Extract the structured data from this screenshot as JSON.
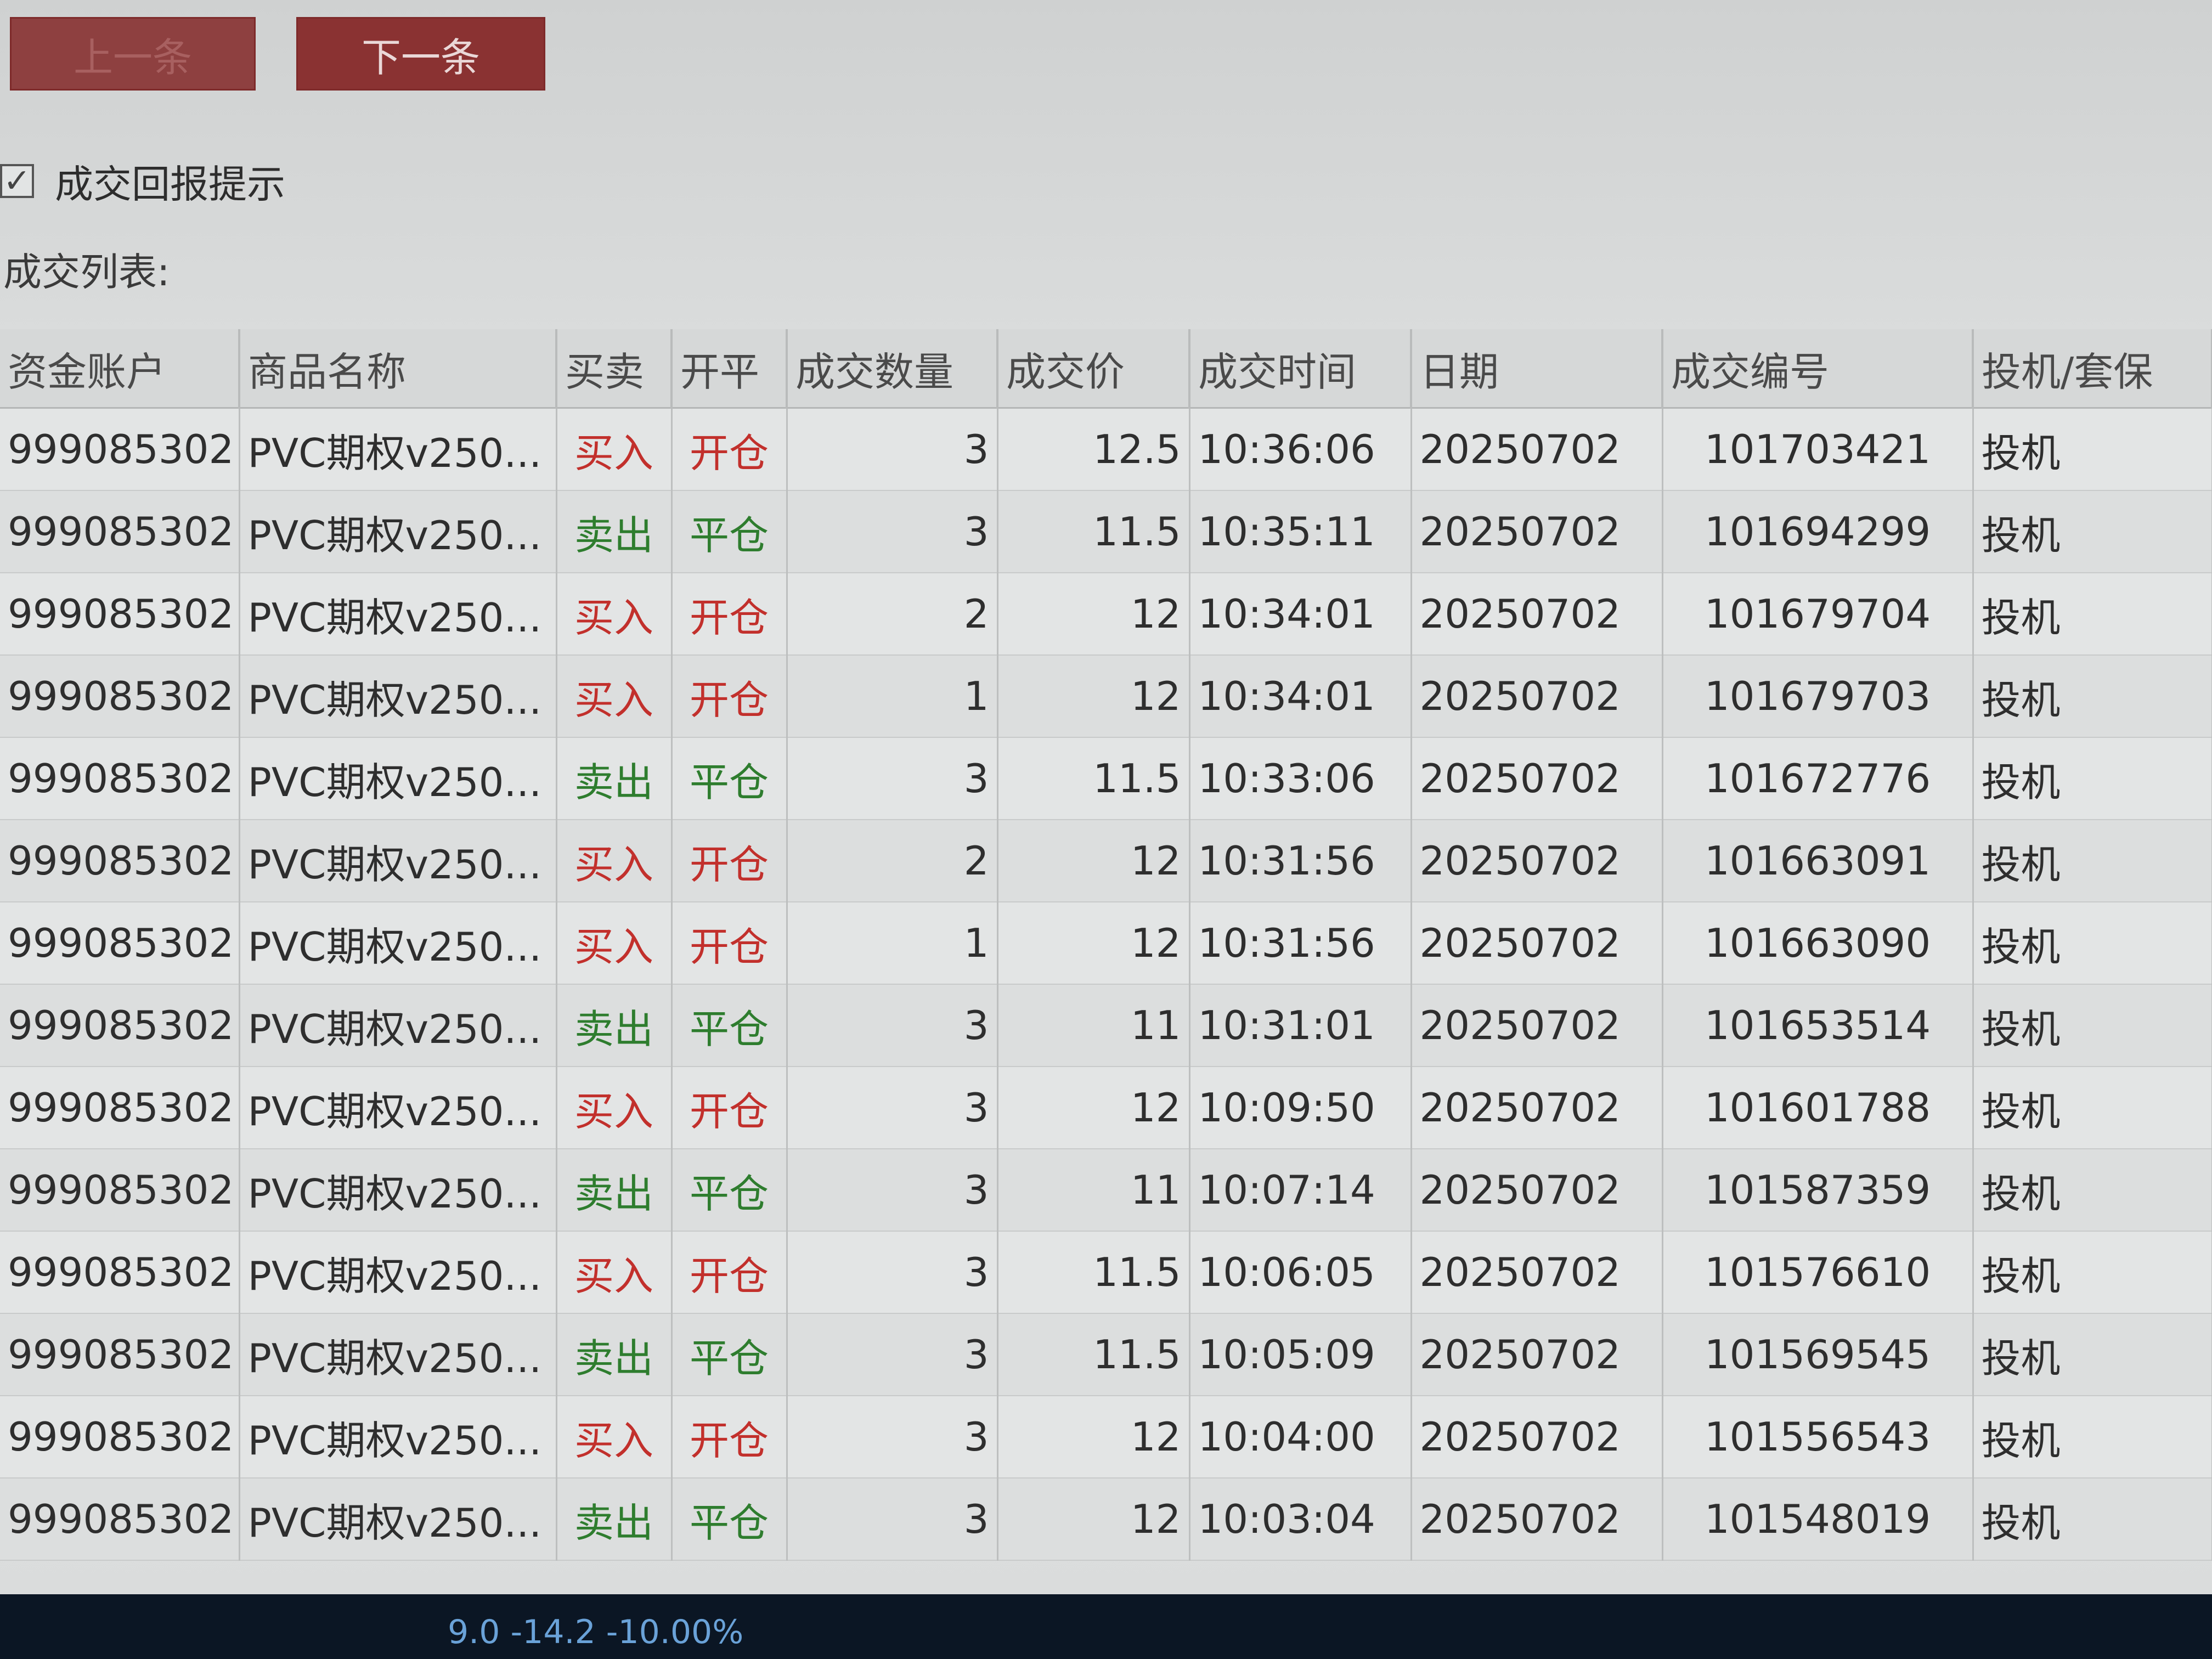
{
  "toolbar": {
    "prev_label": "上一条",
    "next_label": "下一条"
  },
  "notify": {
    "checked": true,
    "label": "成交回报提示"
  },
  "list": {
    "title": "成交列表:"
  },
  "table": {
    "headers": [
      "资金账户",
      "商品名称",
      "买卖",
      "开平",
      "成交数量",
      "成交价",
      "成交时间",
      "日期",
      "成交编号",
      "投机/套保"
    ],
    "rows": [
      {
        "account": "999085302",
        "product": "PVC期权v250...",
        "side": "买入",
        "openclose": "开仓",
        "qty": "3",
        "price": "12.5",
        "time": "10:36:06",
        "date": "20250702",
        "trade_id": "101703421",
        "hedge": "投机"
      },
      {
        "account": "999085302",
        "product": "PVC期权v250...",
        "side": "卖出",
        "openclose": "平仓",
        "qty": "3",
        "price": "11.5",
        "time": "10:35:11",
        "date": "20250702",
        "trade_id": "101694299",
        "hedge": "投机"
      },
      {
        "account": "999085302",
        "product": "PVC期权v250...",
        "side": "买入",
        "openclose": "开仓",
        "qty": "2",
        "price": "12",
        "time": "10:34:01",
        "date": "20250702",
        "trade_id": "101679704",
        "hedge": "投机"
      },
      {
        "account": "999085302",
        "product": "PVC期权v250...",
        "side": "买入",
        "openclose": "开仓",
        "qty": "1",
        "price": "12",
        "time": "10:34:01",
        "date": "20250702",
        "trade_id": "101679703",
        "hedge": "投机"
      },
      {
        "account": "999085302",
        "product": "PVC期权v250...",
        "side": "卖出",
        "openclose": "平仓",
        "qty": "3",
        "price": "11.5",
        "time": "10:33:06",
        "date": "20250702",
        "trade_id": "101672776",
        "hedge": "投机"
      },
      {
        "account": "999085302",
        "product": "PVC期权v250...",
        "side": "买入",
        "openclose": "开仓",
        "qty": "2",
        "price": "12",
        "time": "10:31:56",
        "date": "20250702",
        "trade_id": "101663091",
        "hedge": "投机"
      },
      {
        "account": "999085302",
        "product": "PVC期权v250...",
        "side": "买入",
        "openclose": "开仓",
        "qty": "1",
        "price": "12",
        "time": "10:31:56",
        "date": "20250702",
        "trade_id": "101663090",
        "hedge": "投机"
      },
      {
        "account": "999085302",
        "product": "PVC期权v250...",
        "side": "卖出",
        "openclose": "平仓",
        "qty": "3",
        "price": "11",
        "time": "10:31:01",
        "date": "20250702",
        "trade_id": "101653514",
        "hedge": "投机"
      },
      {
        "account": "999085302",
        "product": "PVC期权v250...",
        "side": "买入",
        "openclose": "开仓",
        "qty": "3",
        "price": "12",
        "time": "10:09:50",
        "date": "20250702",
        "trade_id": "101601788",
        "hedge": "投机"
      },
      {
        "account": "999085302",
        "product": "PVC期权v250...",
        "side": "卖出",
        "openclose": "平仓",
        "qty": "3",
        "price": "11",
        "time": "10:07:14",
        "date": "20250702",
        "trade_id": "101587359",
        "hedge": "投机"
      },
      {
        "account": "999085302",
        "product": "PVC期权v250...",
        "side": "买入",
        "openclose": "开仓",
        "qty": "3",
        "price": "11.5",
        "time": "10:06:05",
        "date": "20250702",
        "trade_id": "101576610",
        "hedge": "投机"
      },
      {
        "account": "999085302",
        "product": "PVC期权v250...",
        "side": "卖出",
        "openclose": "平仓",
        "qty": "3",
        "price": "11.5",
        "time": "10:05:09",
        "date": "20250702",
        "trade_id": "101569545",
        "hedge": "投机"
      },
      {
        "account": "999085302",
        "product": "PVC期权v250...",
        "side": "买入",
        "openclose": "开仓",
        "qty": "3",
        "price": "12",
        "time": "10:04:00",
        "date": "20250702",
        "trade_id": "101556543",
        "hedge": "投机"
      },
      {
        "account": "999085302",
        "product": "PVC期权v250...",
        "side": "卖出",
        "openclose": "平仓",
        "qty": "3",
        "price": "12",
        "time": "10:03:04",
        "date": "20250702",
        "trade_id": "101548019",
        "hedge": "投机"
      }
    ]
  },
  "statusbar": {
    "text": "9.0 -14.2 -10.00%"
  },
  "colors": {
    "buy": "#c2302c",
    "sell": "#2e7d2e",
    "button": "#8a3232",
    "statusbar": "#0b1624"
  }
}
